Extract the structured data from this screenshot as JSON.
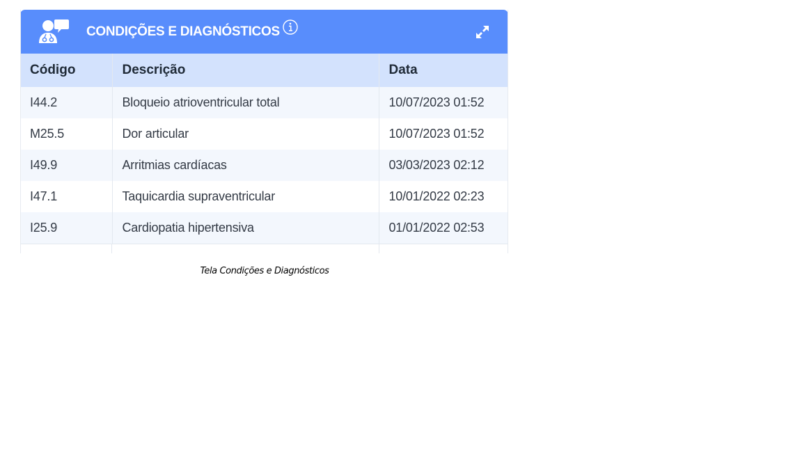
{
  "panel": {
    "title": "CONDIÇÕES E DIAGNÓSTICOS",
    "header_color": "#588dfc",
    "icons": {
      "header": "doctor-chat-icon",
      "info": "info-icon",
      "expand": "expand-icon"
    }
  },
  "table": {
    "headers": [
      "Código",
      "Descrição",
      "Data"
    ],
    "rows": [
      {
        "code": "I44.2",
        "description": "Bloqueio atrioventricular total",
        "date": "10/07/2023 01:52"
      },
      {
        "code": "M25.5",
        "description": "Dor articular",
        "date": "10/07/2023 01:52"
      },
      {
        "code": "I49.9",
        "description": "Arritmias cardíacas",
        "date": "03/03/2023 02:12"
      },
      {
        "code": "I47.1",
        "description": "Taquicardia supraventricular",
        "date": "10/01/2022 02:23"
      },
      {
        "code": "I25.9",
        "description": "Cardiopatia hipertensiva",
        "date": "01/01/2022 02:53"
      }
    ]
  },
  "caption": "Tela Condições e Diagnósticos"
}
